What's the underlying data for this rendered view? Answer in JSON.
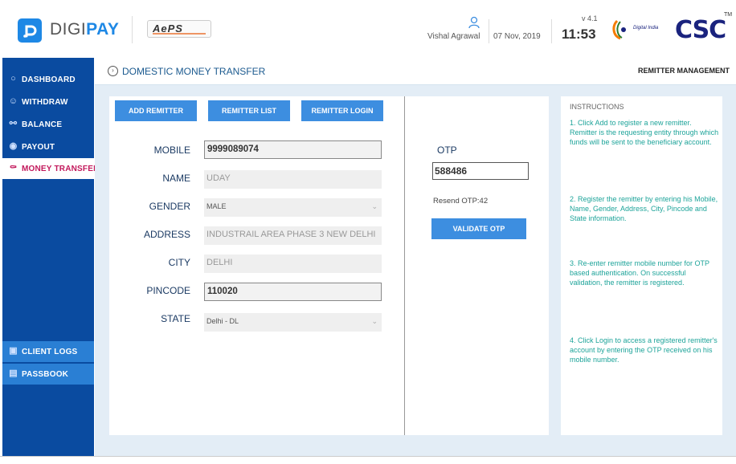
{
  "header": {
    "brand_prefix": "DIGI",
    "brand_suffix": "PAY",
    "aeps_logo": "AePS",
    "user_name": "Vishal Agrawal",
    "date": "07 Nov, 2019",
    "version": "v 4.1",
    "time": "11:53",
    "digital_india": "Digital India",
    "csc_logo": "CSC",
    "trademark": "TM"
  },
  "sidebar": {
    "items": [
      {
        "label": "DASHBOARD",
        "icon": "dashboard-icon"
      },
      {
        "label": "WITHDRAW",
        "icon": "withdraw-icon"
      },
      {
        "label": "BALANCE",
        "icon": "balance-icon"
      },
      {
        "label": "PAYOUT",
        "icon": "payout-icon"
      },
      {
        "label": "MONEY TRANSFER",
        "icon": "money-transfer-icon"
      },
      {
        "label": "CLIENT LOGS",
        "icon": "client-logs-icon"
      },
      {
        "label": "PASSBOOK",
        "icon": "passbook-icon"
      }
    ]
  },
  "breadcrumb": {
    "title": "DOMESTIC MONEY TRANSFER",
    "right": "REMITTER MANAGEMENT"
  },
  "actions": {
    "add_remitter": "ADD REMITTER",
    "remitter_list": "REMITTER LIST",
    "remitter_login": "REMITTER LOGIN"
  },
  "form": {
    "mobile_label": "MOBILE",
    "mobile_value": "9999089074",
    "name_label": "NAME",
    "name_value": "UDAY",
    "gender_label": "GENDER",
    "gender_value": "MALE",
    "address_label": "ADDRESS",
    "address_value": "INDUSTRAIL AREA PHASE 3 NEW DELHI",
    "city_label": "CITY",
    "city_value": "DELHI",
    "pincode_label": "PINCODE",
    "pincode_value": "110020",
    "state_label": "STATE",
    "state_value": "Delhi - DL"
  },
  "otp": {
    "label": "OTP",
    "value": "588486",
    "resend": "Resend OTP:42",
    "validate": "VALIDATE OTP"
  },
  "instructions": {
    "title": "INSTRUCTIONS",
    "step1": "1. Click Add to register a new remitter. Remitter is the requesting entity through which funds will be sent to the beneficiary account.",
    "step2": "2. Register the remitter by entering his Mobile, Name, Gender, Address, City, Pincode and State information.",
    "step3": "3. Re-enter remitter mobile number for OTP based authentication. On successful validation, the remitter is registered.",
    "step4": "4. Click Login to access a registered remitter's account by entering the OTP received on his mobile number."
  },
  "colors": {
    "sidebar": "#0a4ba0",
    "accent": "#3d8ee0",
    "active_text": "#c2185b",
    "instruction_text": "#1ea49a"
  }
}
